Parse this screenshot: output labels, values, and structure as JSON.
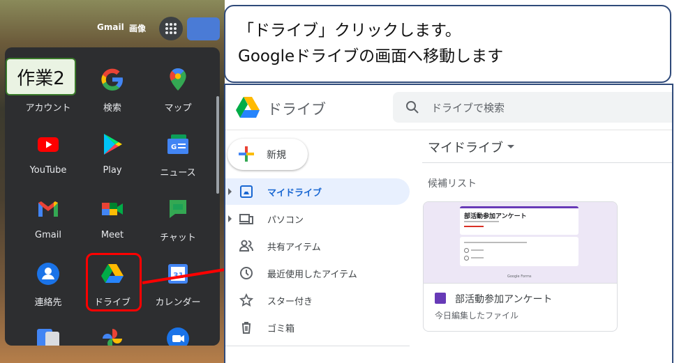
{
  "header": {
    "gmail_label": "Gmail",
    "images_label": "画像"
  },
  "step_tag": "作業2",
  "apps": [
    {
      "label": "アカウント",
      "icon": "account-icon"
    },
    {
      "label": "検索",
      "icon": "google-search-icon"
    },
    {
      "label": "マップ",
      "icon": "maps-icon"
    },
    {
      "label": "YouTube",
      "icon": "youtube-icon"
    },
    {
      "label": "Play",
      "icon": "play-icon"
    },
    {
      "label": "ニュース",
      "icon": "news-icon"
    },
    {
      "label": "Gmail",
      "icon": "gmail-icon"
    },
    {
      "label": "Meet",
      "icon": "meet-icon"
    },
    {
      "label": "チャット",
      "icon": "chat-icon"
    },
    {
      "label": "連絡先",
      "icon": "contacts-icon"
    },
    {
      "label": "ドライブ",
      "icon": "drive-icon"
    },
    {
      "label": "カレンダー",
      "icon": "calendar-icon"
    }
  ],
  "callout": {
    "line1": "「ドライブ」クリックします。",
    "line2": "Googleドライブの画面へ移動します"
  },
  "drive": {
    "title": "ドライブ",
    "search_placeholder": "ドライブで検索",
    "new_label": "新規",
    "nav": [
      {
        "label": "マイドライブ",
        "icon": "my-drive-icon",
        "active": true
      },
      {
        "label": "パソコン",
        "icon": "computer-icon"
      },
      {
        "label": "共有アイテム",
        "icon": "shared-icon"
      },
      {
        "label": "最近使用したアイテム",
        "icon": "recent-icon"
      },
      {
        "label": "スター付き",
        "icon": "star-icon"
      },
      {
        "label": "ゴミ箱",
        "icon": "trash-icon"
      }
    ],
    "main_title": "マイドライブ",
    "suggested_label": "候補リスト",
    "file": {
      "name": "部活動参加アンケート",
      "subtitle": "今日編集したファイル",
      "thumb_title": "部活動参加アンケート",
      "thumb_brand": "Google Forms"
    }
  },
  "colors": {
    "highlight": "#ff0000",
    "tag_border": "#3a7a2a",
    "callout_border": "#2f4a7a",
    "active_nav": "#1967d2"
  }
}
